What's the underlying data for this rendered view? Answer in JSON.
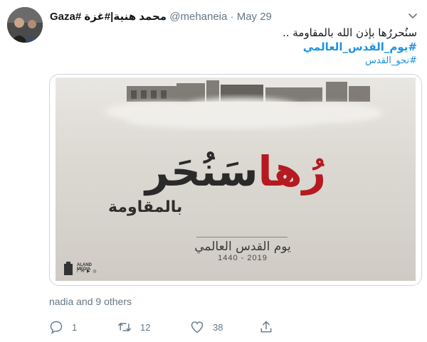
{
  "tweet": {
    "author_name": "Gaza# محمد هنية|#غزة",
    "handle": "@mehaneia",
    "separator": "·",
    "date": "May 29",
    "text_line": "سنُحررُها بإذن الله بالمقاومة ..",
    "hashtag_primary": "#يوم_القدس_العالمي",
    "hashtag_secondary": "#نحو_القدس"
  },
  "media": {
    "title_dark": "سَنُحَر",
    "title_red": "رُها",
    "subtitle": "بالمقاومة",
    "event_name": "يوم القدس العالمي",
    "years": "1440 - 2019",
    "logo_text": "ALAND MEDIA",
    "logo_icons": "f ✉ ▶ ◎"
  },
  "engagement": {
    "liked_by": "nadia and 9 others",
    "replies": "1",
    "retweets": "12",
    "likes": "38"
  },
  "icons": {
    "reply": "reply-icon",
    "retweet": "retweet-icon",
    "like": "heart-icon",
    "share": "share-icon",
    "menu": "chevron-down-icon"
  },
  "colors": {
    "link": "#1b95e0",
    "muted": "#657786",
    "accent_red": "#b51a22"
  }
}
